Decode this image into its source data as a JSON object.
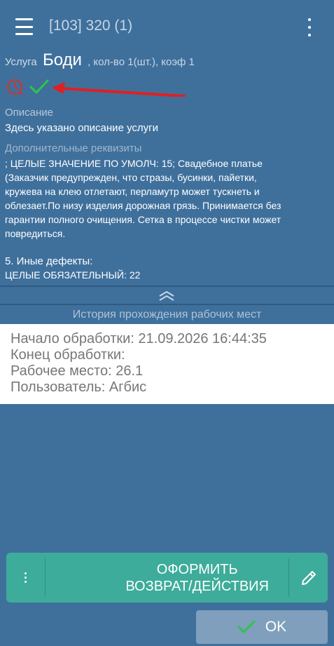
{
  "appbar": {
    "title": "[103] 320 (1)"
  },
  "service": {
    "label": "Услуга",
    "name": "Боди",
    "details": ", кол-во 1(шт.), коэф 1"
  },
  "status_icons": [
    "clock-icon",
    "checkmark-icon",
    "arrow-annotation"
  ],
  "description": {
    "label": "Описание",
    "text": "Здесь указано описание услуги"
  },
  "requisites": {
    "label": "Дополнительные реквизиты",
    "lines": [
      "; ЦЕЛЫЕ ЗНАЧЕНИЕ ПО УМОЛЧ: 15; Свадебное платье",
      "(Заказчик предупрежден, что стразы, бусинки, пайетки,",
      "кружева на клею отлетают, перламутр может тускнеть и",
      "облезает.По низу изделия дорожная грязь. Принимается без",
      "гарантии полного очищения. Сетка в процессе чистки может",
      "повредиться."
    ]
  },
  "defects": {
    "title": "5. Иные дефекты:",
    "value": "ЦЕЛЫЕ ОБЯЗАТЕЛЬНЫЙ: 22"
  },
  "history": {
    "header": "История прохождения рабочих мест",
    "start": "Начало обработки: 21.09.2026 16:44:35",
    "end": "Конец обработки:",
    "workplace": "Рабочее место: 26.1",
    "user": "Пользователь: Агбис"
  },
  "actions": {
    "main_line1": "ОФОРМИТЬ",
    "main_line2": "ВОЗВРАТ/ДЕЙСТВИЯ",
    "ok_label": "OK"
  },
  "colors": {
    "background": "#3f709c",
    "action_bar": "#3dac9a",
    "ok_button": "#7f9fbd",
    "check_green": "#2ec44a",
    "clock_red": "#d9302a",
    "arrow_red": "#e02020"
  }
}
